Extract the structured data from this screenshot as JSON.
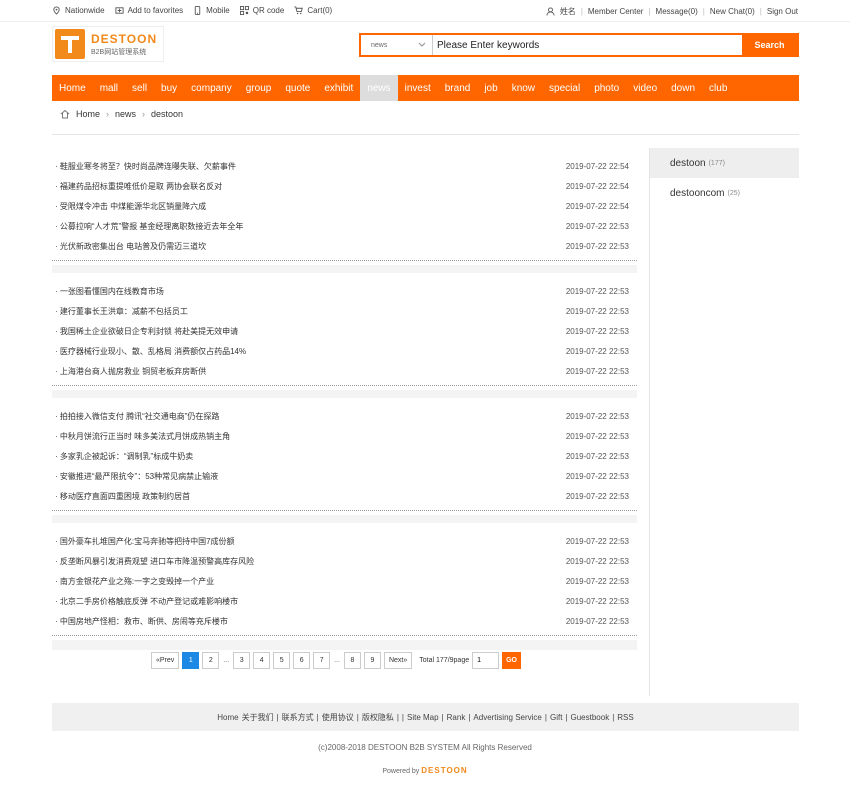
{
  "topbar": {
    "left": [
      "Nationwide",
      "Add to favorites",
      "Mobile",
      "QR code",
      "Cart(0)"
    ],
    "right": [
      "姓名",
      "Member Center",
      "Message(0)",
      "New Chat(0)",
      "Sign Out"
    ]
  },
  "logo": {
    "brand": "DESTOON",
    "sub": "B2B网站管理系统"
  },
  "search": {
    "category": "news",
    "placeholder": "Please Enter keywords",
    "button": "Search"
  },
  "nav": [
    "Home",
    "mall",
    "sell",
    "buy",
    "company",
    "group",
    "quote",
    "exhibit",
    "news",
    "invest",
    "brand",
    "job",
    "know",
    "special",
    "photo",
    "video",
    "down",
    "club"
  ],
  "nav_active": "news",
  "breadcrumb": [
    "Home",
    "news",
    "destoon"
  ],
  "groups": [
    [
      {
        "title": "鞋服业寒冬将至？快时尚品牌连曝失联、欠薪事件",
        "date": "2019-07-22 22:54"
      },
      {
        "title": "福建药品招标重提唯低价是取 两协会联名反对",
        "date": "2019-07-22 22:54"
      },
      {
        "title": "受限煤令冲击 中煤能源华北区销量降六成",
        "date": "2019-07-22 22:54"
      },
      {
        "title": "公募拉响“人才荒”警报 基金经理离职数接近去年全年",
        "date": "2019-07-22 22:53"
      },
      {
        "title": "光伏新政密集出台 电站普及仍需迈三道坎",
        "date": "2019-07-22 22:53"
      }
    ],
    [
      {
        "title": "一张图看懂国内在线教育市场",
        "date": "2019-07-22 22:53"
      },
      {
        "title": "建行董事长王洪章：减薪不包括员工",
        "date": "2019-07-22 22:53"
      },
      {
        "title": "我国稀土企业欲破日企专利封锁 将赴美提无效申请",
        "date": "2019-07-22 22:53"
      },
      {
        "title": "医疗器械行业现小、散、乱格局 消费额仅占药品14%",
        "date": "2019-07-22 22:53"
      },
      {
        "title": "上海港台商人抛房救业 铜贸老板弃房断供",
        "date": "2019-07-22 22:53"
      }
    ],
    [
      {
        "title": "拍拍接入微信支付 腾讯“社交通电商”仍在探路",
        "date": "2019-07-22 22:53"
      },
      {
        "title": "中秋月饼流行正当时 味多美法式月饼成热销主角",
        "date": "2019-07-22 22:53"
      },
      {
        "title": "多家乳企被起诉：“调制乳”标成牛奶卖",
        "date": "2019-07-22 22:53"
      },
      {
        "title": "安徽推进“最严限抗令”：53种常见病禁止输液",
        "date": "2019-07-22 22:53"
      },
      {
        "title": "移动医疗直面四重困境 政策制约居首",
        "date": "2019-07-22 22:53"
      }
    ],
    [
      {
        "title": "国外豪车扎堆国产化:宝马奔驰等把持中国7成份额",
        "date": "2019-07-22 22:53"
      },
      {
        "title": "反垄断风暴引发消费观望 进口车市降温预警高库存风险",
        "date": "2019-07-22 22:53"
      },
      {
        "title": "南方金银花产业之殇:一字之变毁掉一个产业",
        "date": "2019-07-22 22:53"
      },
      {
        "title": "北京二手房价格触底反弹 不动产登记或难影响楼市",
        "date": "2019-07-22 22:53"
      },
      {
        "title": "中国房地产怪相：救市、断供、房闹等充斥楼市",
        "date": "2019-07-22 22:53"
      }
    ]
  ],
  "pager": {
    "prev": "«Prev",
    "pages_a": [
      "1",
      "2"
    ],
    "pages_b": [
      "3",
      "4",
      "5",
      "6",
      "7"
    ],
    "pages_c": [
      "8",
      "9"
    ],
    "ellipsis": "...",
    "next": "Next»",
    "total": "Total 177/9page",
    "input_value": "1",
    "go": "GO"
  },
  "side": [
    {
      "label": "destoon",
      "count": "(177)"
    },
    {
      "label": "destooncom",
      "count": "(25)"
    }
  ],
  "footer": {
    "links": [
      "Home",
      "关于我们",
      "|",
      "联系方式",
      "|",
      "使用协议",
      "|",
      "版权隐私",
      "|",
      "|",
      "Site Map",
      "|",
      "Rank",
      "|",
      "Advertising Service",
      "|",
      "Gift",
      "|",
      "Guestbook",
      "|",
      "RSS"
    ],
    "copyright": "(c)2008-2018 DESTOON B2B SYSTEM All Rights Reserved",
    "powered": "Powered by",
    "powered_brand": "DESTOON"
  }
}
